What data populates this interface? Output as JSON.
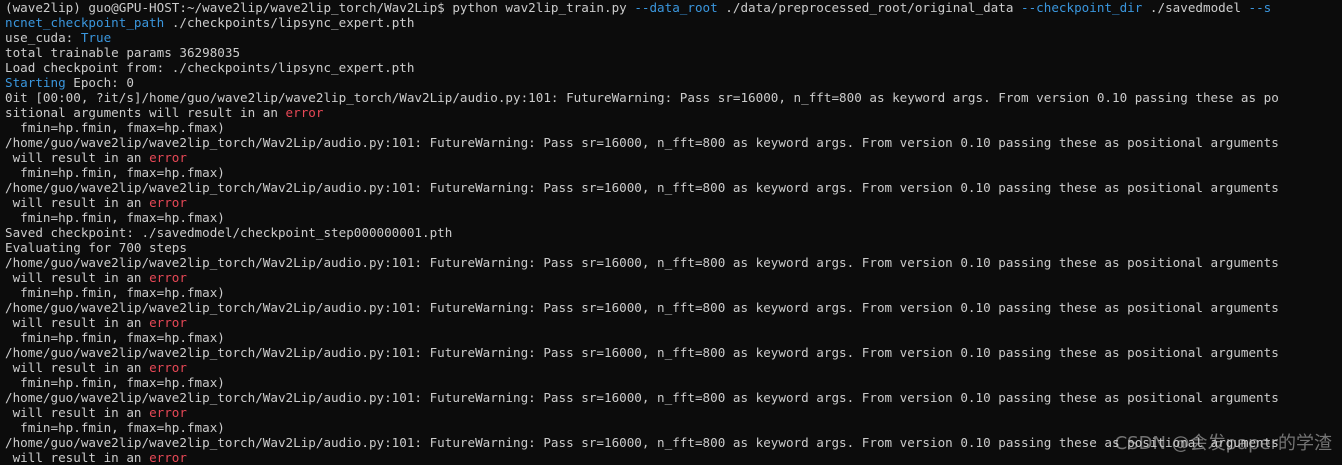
{
  "terminal": {
    "lines": [
      {
        "parts": [
          {
            "text": "(wave2lip) guo@GPU-HOST:~/wave2lip/wave2lip_torch/Wav2Lip$ python wav2lip_train.py "
          },
          {
            "text": "--data_root",
            "color": "cyan"
          },
          {
            "text": " ./data/preprocessed_root/original_data "
          },
          {
            "text": "--checkpoint_dir",
            "color": "cyan"
          },
          {
            "text": " ./savedmodel "
          },
          {
            "text": "--s",
            "color": "cyan"
          }
        ]
      },
      {
        "parts": [
          {
            "text": "ncnet_checkpoint_path",
            "color": "cyan"
          },
          {
            "text": " ./checkpoints/lipsync_expert.pth"
          }
        ]
      },
      {
        "parts": [
          {
            "text": "use_cuda: "
          },
          {
            "text": "True",
            "color": "cyan"
          }
        ]
      },
      {
        "parts": [
          {
            "text": "total trainable params 36298035"
          }
        ]
      },
      {
        "parts": [
          {
            "text": "Load checkpoint from: ./checkpoints/lipsync_expert.pth"
          }
        ]
      },
      {
        "parts": [
          {
            "text": "Starting",
            "color": "cyan"
          },
          {
            "text": " Epoch: 0"
          }
        ]
      },
      {
        "parts": [
          {
            "text": "0it [00:00, ?it/s]/home/guo/wave2lip/wave2lip_torch/Wav2Lip/audio.py:101: FutureWarning: Pass sr=16000, n_fft=800 as keyword args. From version 0.10 passing these as po"
          }
        ]
      },
      {
        "parts": [
          {
            "text": "sitional arguments will result in an "
          },
          {
            "text": "error",
            "color": "red"
          }
        ]
      },
      {
        "parts": [
          {
            "text": "  fmin=hp.fmin, fmax=hp.fmax)"
          }
        ]
      },
      {
        "parts": [
          {
            "text": "/home/guo/wave2lip/wave2lip_torch/Wav2Lip/audio.py:101: FutureWarning: Pass sr=16000, n_fft=800 as keyword args. From version 0.10 passing these as positional arguments"
          }
        ]
      },
      {
        "parts": [
          {
            "text": " will result in an "
          },
          {
            "text": "error",
            "color": "red"
          }
        ]
      },
      {
        "parts": [
          {
            "text": "  fmin=hp.fmin, fmax=hp.fmax)"
          }
        ]
      },
      {
        "parts": [
          {
            "text": "/home/guo/wave2lip/wave2lip_torch/Wav2Lip/audio.py:101: FutureWarning: Pass sr=16000, n_fft=800 as keyword args. From version 0.10 passing these as positional arguments"
          }
        ]
      },
      {
        "parts": [
          {
            "text": " will result in an "
          },
          {
            "text": "error",
            "color": "red"
          }
        ]
      },
      {
        "parts": [
          {
            "text": "  fmin=hp.fmin, fmax=hp.fmax)"
          }
        ]
      },
      {
        "parts": [
          {
            "text": "Saved checkpoint: ./savedmodel/checkpoint_step000000001.pth"
          }
        ]
      },
      {
        "parts": [
          {
            "text": "Evaluating for 700 steps"
          }
        ]
      },
      {
        "parts": [
          {
            "text": "/home/guo/wave2lip/wave2lip_torch/Wav2Lip/audio.py:101: FutureWarning: Pass sr=16000, n_fft=800 as keyword args. From version 0.10 passing these as positional arguments"
          }
        ]
      },
      {
        "parts": [
          {
            "text": " will result in an "
          },
          {
            "text": "error",
            "color": "red"
          }
        ]
      },
      {
        "parts": [
          {
            "text": "  fmin=hp.fmin, fmax=hp.fmax)"
          }
        ]
      },
      {
        "parts": [
          {
            "text": "/home/guo/wave2lip/wave2lip_torch/Wav2Lip/audio.py:101: FutureWarning: Pass sr=16000, n_fft=800 as keyword args. From version 0.10 passing these as positional arguments"
          }
        ]
      },
      {
        "parts": [
          {
            "text": " will result in an "
          },
          {
            "text": "error",
            "color": "red"
          }
        ]
      },
      {
        "parts": [
          {
            "text": "  fmin=hp.fmin, fmax=hp.fmax)"
          }
        ]
      },
      {
        "parts": [
          {
            "text": "/home/guo/wave2lip/wave2lip_torch/Wav2Lip/audio.py:101: FutureWarning: Pass sr=16000, n_fft=800 as keyword args. From version 0.10 passing these as positional arguments"
          }
        ]
      },
      {
        "parts": [
          {
            "text": " will result in an "
          },
          {
            "text": "error",
            "color": "red"
          }
        ]
      },
      {
        "parts": [
          {
            "text": "  fmin=hp.fmin, fmax=hp.fmax)"
          }
        ]
      },
      {
        "parts": [
          {
            "text": "/home/guo/wave2lip/wave2lip_torch/Wav2Lip/audio.py:101: FutureWarning: Pass sr=16000, n_fft=800 as keyword args. From version 0.10 passing these as positional arguments"
          }
        ]
      },
      {
        "parts": [
          {
            "text": " will result in an "
          },
          {
            "text": "error",
            "color": "red"
          }
        ]
      },
      {
        "parts": [
          {
            "text": "  fmin=hp.fmin, fmax=hp.fmax)"
          }
        ]
      },
      {
        "parts": [
          {
            "text": "/home/guo/wave2lip/wave2lip_torch/Wav2Lip/audio.py:101: FutureWarning: Pass sr=16000, n_fft=800 as keyword args. From version 0.10 passing these as positional arguments"
          }
        ]
      },
      {
        "parts": [
          {
            "text": " will result in an "
          },
          {
            "text": "error",
            "color": "red"
          }
        ]
      }
    ]
  },
  "watermark": "CSDN @会发paper的学渣",
  "colors": {
    "background": "#0c0c0c",
    "foreground": "#cccccc",
    "cyan": "#3a96dd",
    "red": "#e74856"
  }
}
